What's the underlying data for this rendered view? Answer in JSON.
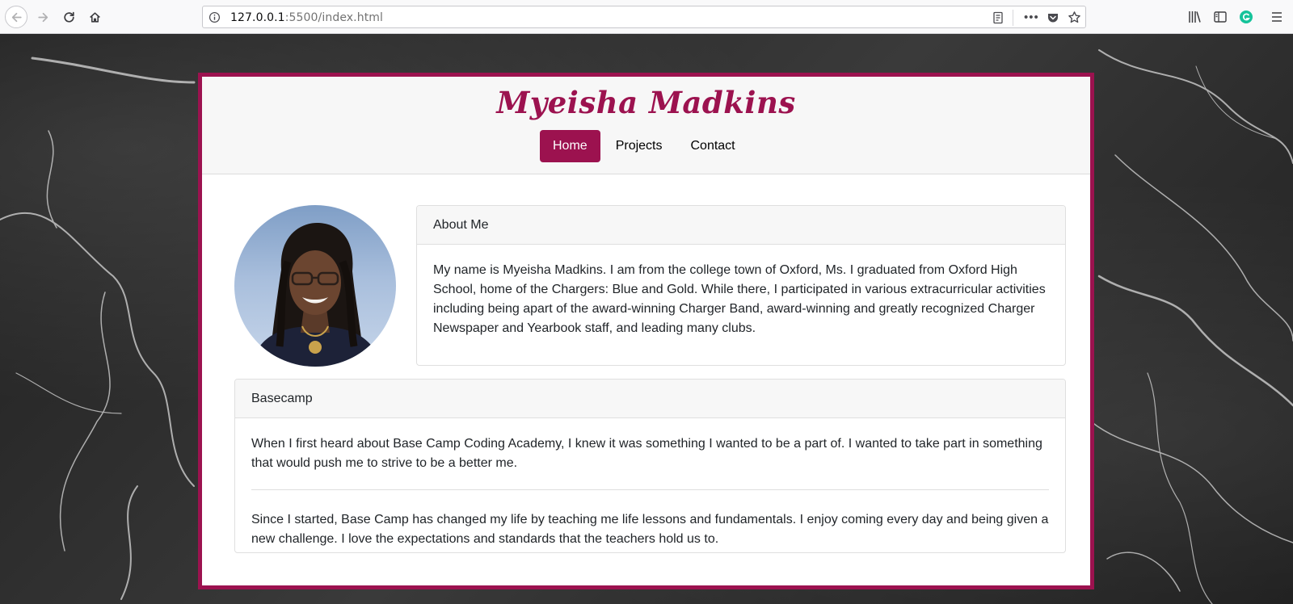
{
  "browser": {
    "url_host": "127.0.0.1",
    "url_rest": ":5500/index.html"
  },
  "site": {
    "title": "Myeisha Madkins",
    "nav": [
      {
        "label": "Home",
        "active": true
      },
      {
        "label": "Projects",
        "active": false
      },
      {
        "label": "Contact",
        "active": false
      }
    ],
    "accent_color": "#9c124f"
  },
  "about": {
    "heading": "About Me",
    "text": "My name is Myeisha Madkins. I am from the college town of Oxford, Ms. I graduated from Oxford High School, home of the Chargers: Blue and Gold. While there, I participated in various extracurricular activities including being apart of the award-winning Charger Band, award-winning and greatly recognized Charger Newspaper and Yearbook staff, and leading many clubs."
  },
  "basecamp": {
    "heading": "Basecamp",
    "paragraphs": [
      "When I first heard about Base Camp Coding Academy, I knew it was something I wanted to be a part of. I wanted to take part in something that would push me to strive to be a better me.",
      "Since I started, Base Camp has changed my life by teaching me life lessons and fundamentals. I enjoy coming every day and being given a new challenge. I love the expectations and standards that the teachers hold us to."
    ]
  }
}
